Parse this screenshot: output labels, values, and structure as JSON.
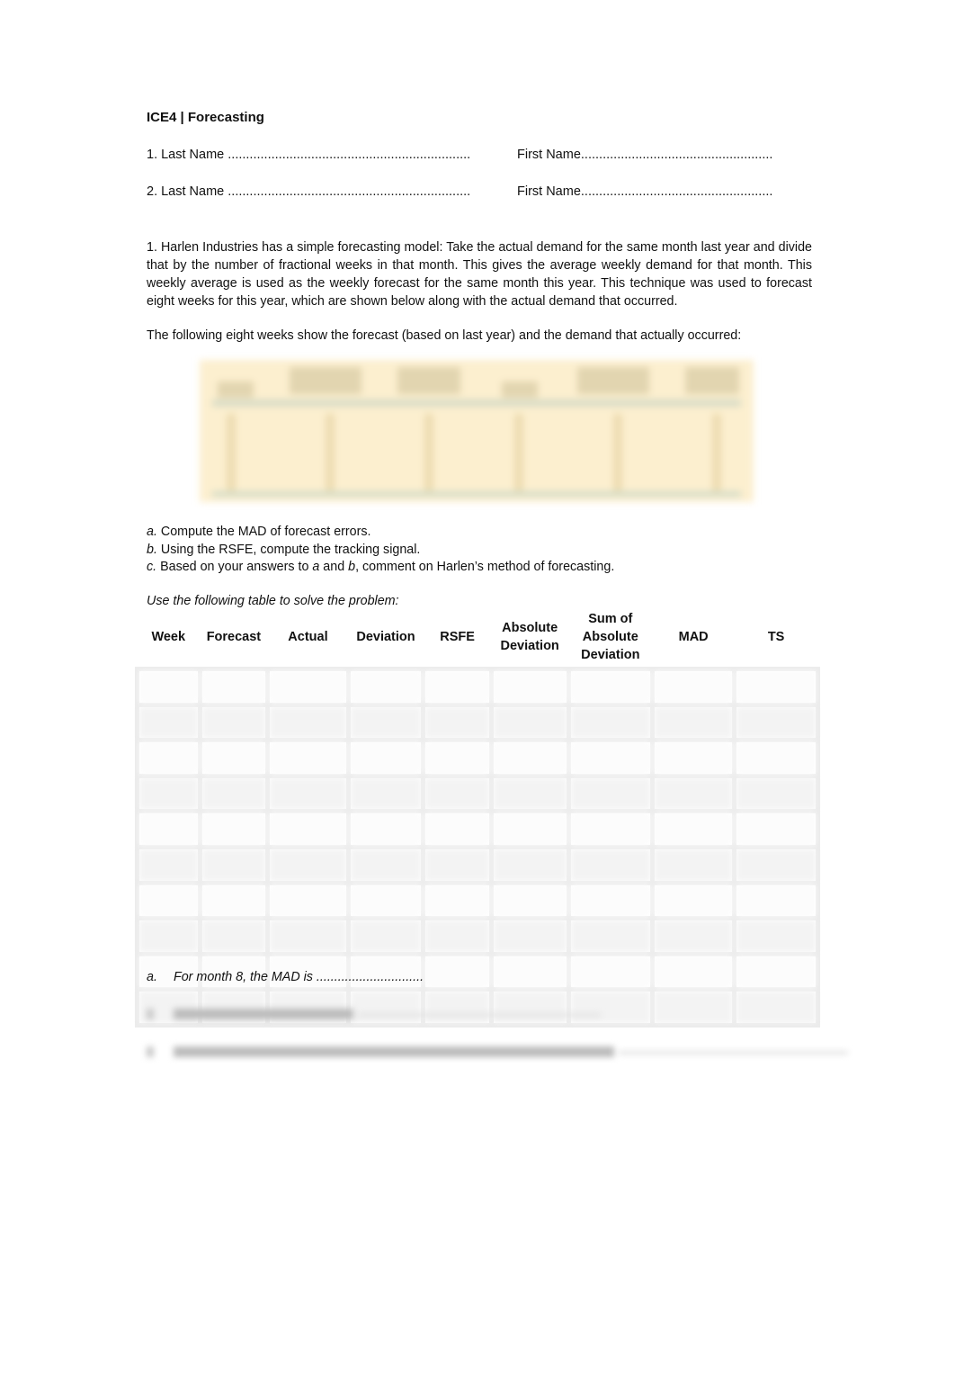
{
  "header": {
    "title": "ICE4 | Forecasting"
  },
  "names": [
    {
      "last_label": "1. Last Name ",
      "last_dots": "...................................................................",
      "first_label": "First Name",
      "first_dots": "....................................................."
    },
    {
      "last_label": "2. Last Name ",
      "last_dots": "...................................................................",
      "first_label": "First Name",
      "first_dots": "....................................................."
    }
  ],
  "problem": {
    "intro": "1. Harlen Industries has a simple forecasting model: Take the actual demand for the same month last year and divide that by the number of fractional weeks in that month. This gives the average weekly demand for that month. This weekly average is used as the weekly forecast for the same month this year. This technique was used to forecast eight weeks for this year, which are shown below along with the actual demand that occurred.",
    "followup": "The following eight weeks show the forecast (based on last year) and the demand that actually occurred:",
    "embedded_image": "blurred-forecast-demand-table",
    "questions": [
      {
        "letter": "a.",
        "parts": [
          " Compute the MAD of forecast errors."
        ]
      },
      {
        "letter": "b.",
        "parts": [
          " Using the RSFE, compute the tracking signal."
        ]
      },
      {
        "letter": "c.",
        "pre": " Based on your answers to ",
        "i1": "a",
        "mid": " and ",
        "i2": "b",
        "post": ", comment on Harlen’s method of forecasting."
      }
    ],
    "table_note": "Use the following table to solve the problem:"
  },
  "answer_table": {
    "columns": [
      "Week",
      "Forecast",
      "Actual",
      "Deviation",
      "RSFE",
      "Absolute Deviation",
      "Sum of Absolute Deviation",
      "MAD",
      "TS"
    ],
    "rows": 10
  },
  "answers": {
    "a_letter": "a.",
    "a_text": "For month 8, the MAD is .............................."
  }
}
